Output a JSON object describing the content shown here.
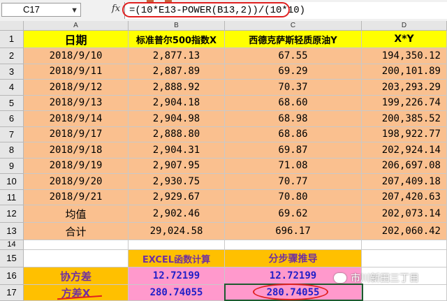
{
  "formula_bar": {
    "name_box": "C17",
    "fx_symbol": "fx",
    "formula": "=(10*E13-POWER(B13,2))/(10*10)"
  },
  "columns": [
    "A",
    "B",
    "C",
    "D"
  ],
  "headers": {
    "date": "日期",
    "x": "标准普尔500指数X",
    "y": "西德克萨斯轻质原油Y",
    "xy": "X*Y"
  },
  "rows": [
    {
      "num": "2",
      "date": "2018/9/10",
      "x": "2,877.13",
      "y": "67.55",
      "xy": "194,350.12"
    },
    {
      "num": "3",
      "date": "2018/9/11",
      "x": "2,887.89",
      "y": "69.29",
      "xy": "200,101.89"
    },
    {
      "num": "4",
      "date": "2018/9/12",
      "x": "2,888.92",
      "y": "70.37",
      "xy": "203,293.29"
    },
    {
      "num": "5",
      "date": "2018/9/13",
      "x": "2,904.18",
      "y": "68.60",
      "xy": "199,226.74"
    },
    {
      "num": "6",
      "date": "2018/9/14",
      "x": "2,904.98",
      "y": "68.98",
      "xy": "200,385.52"
    },
    {
      "num": "7",
      "date": "2018/9/17",
      "x": "2,888.80",
      "y": "68.86",
      "xy": "198,922.77"
    },
    {
      "num": "8",
      "date": "2018/9/18",
      "x": "2,904.31",
      "y": "69.87",
      "xy": "202,924.14"
    },
    {
      "num": "9",
      "date": "2018/9/19",
      "x": "2,907.95",
      "y": "71.08",
      "xy": "206,697.08"
    },
    {
      "num": "10",
      "date": "2018/9/20",
      "x": "2,930.75",
      "y": "70.77",
      "xy": "207,409.18"
    },
    {
      "num": "11",
      "date": "2018/9/21",
      "x": "2,929.67",
      "y": "70.80",
      "xy": "207,420.63"
    }
  ],
  "mean_row": {
    "num": "12",
    "label": "均值",
    "x": "2,902.46",
    "y": "69.62",
    "xy": "202,073.14"
  },
  "total_row": {
    "num": "13",
    "label": "合计",
    "x": "29,024.58",
    "y": "696.17",
    "xy": "202,060.42"
  },
  "row14": {
    "num": "14"
  },
  "calc_header": {
    "num": "15",
    "excel": "EXCEL函数计算",
    "manual": "分步骤推导"
  },
  "covariance": {
    "num": "16",
    "label": "协方差",
    "excel": "12.72199",
    "manual": "12.72199"
  },
  "variance": {
    "num": "17",
    "label": "方差X",
    "excel": "280.74055",
    "manual": "280.74055"
  },
  "watermark": "市川新田三丁目",
  "colors": {
    "yellow": "#ffff00",
    "peach": "#fac08f",
    "pink": "#ff99cc",
    "orange": "#ffc000",
    "annotation_red": "#e02020",
    "selection_green": "#1c5a2e"
  }
}
